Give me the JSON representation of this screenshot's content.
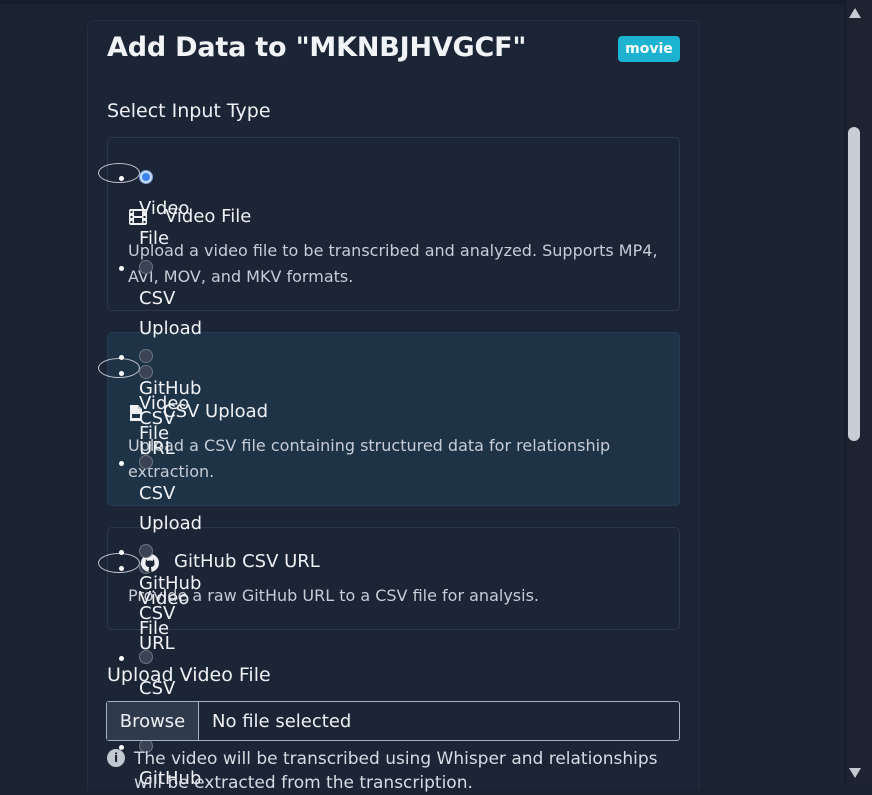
{
  "dialog": {
    "title": "Add Data to \"MKNBJHVGCF\"",
    "badge": "movie"
  },
  "input_type": {
    "label": "Select Input Type",
    "options": [
      {
        "id": "video",
        "title": "Video File",
        "description": "Upload a video file to be transcribed and analyzed. Supports MP4, AVI, MOV, and MKV formats.",
        "selected": false,
        "icon": "film-icon"
      },
      {
        "id": "csv",
        "title": "CSV Upload",
        "description": "Upload a CSV file containing structured data for relationship extraction.",
        "selected": true,
        "icon": "file-csv-icon"
      },
      {
        "id": "github",
        "title": "GitHub CSV URL",
        "description": "Provide a raw GitHub URL to a CSV file for analysis.",
        "selected": false,
        "icon": "github-icon"
      }
    ],
    "ghost_labels": {
      "video_file_a": "Video",
      "video_file_b": "File",
      "csv_upload_a": "CSV",
      "csv_upload_b": "Upload",
      "github_a": "GitHub",
      "github_b": "CSV",
      "github_c": "URL"
    }
  },
  "upload": {
    "label": "Upload Video File",
    "browse_label": "Browse",
    "no_file_label": "No file selected",
    "help_text": "The video will be transcribed using Whisper and relationships will be extracted from the transcription."
  },
  "colors": {
    "background": "#1b2333",
    "accent_badge": "#1cb2d2",
    "selected_option": "#1e3346",
    "radio_checked": "#3b82f6"
  }
}
